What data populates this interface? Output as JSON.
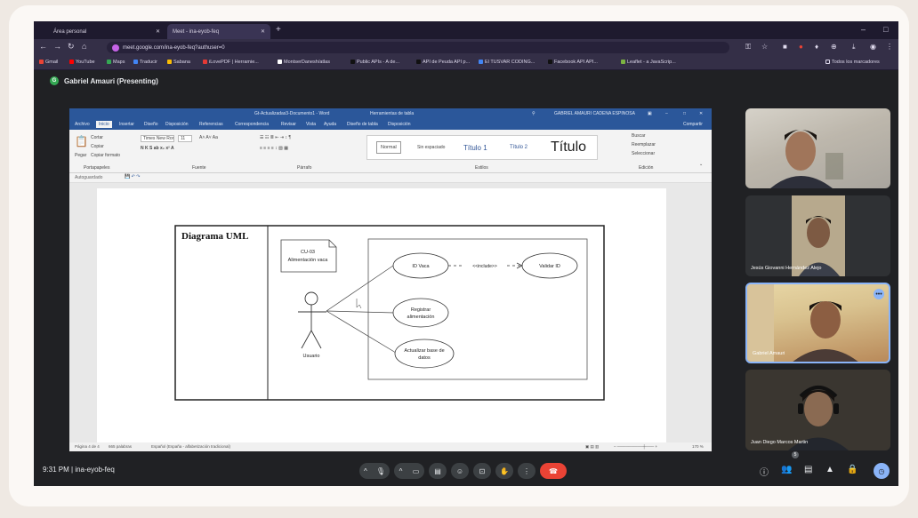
{
  "browser": {
    "tabs": [
      {
        "label": "Área personal"
      },
      {
        "label": "Meet - ina-eyob-feq"
      }
    ],
    "url": "meet.google.com/ina-eyob-feq?authuser=0",
    "bookmarks": [
      "Gmail",
      "YouTube",
      "Maps",
      "Traducir",
      "Sabana",
      "iLovePDF | Herramie...",
      "MontserDanesh/atlas",
      "Public APIs - A de...",
      "API de Peuda API p...",
      "El TUSVAR CODING...",
      "Facebook API API...",
      "Leaflet - a JavaScrip..."
    ],
    "all_bookmarks": "Todos los marcadores"
  },
  "meet": {
    "presenter_initial": "G",
    "presenter_label": "Gabriel Amauri (Presenting)",
    "meeting_time": "9:31 PM",
    "meeting_code": "ina-eyob-feq",
    "participant_count": "5",
    "participants": [
      {
        "name": ""
      },
      {
        "name": "Jesús Giovanni Hernández Alejo"
      },
      {
        "name": "Gabriel Amauri"
      },
      {
        "name": "Juan Diego Marcos Martin"
      }
    ]
  },
  "word": {
    "doc_title": "Gt-Actualizadas3-Documento1 - Word",
    "tools_label": "Herramientas de tabla",
    "user": "GABRIEL AMAURI CADENA ESPINOSA",
    "tabs": [
      "Archivo",
      "Inicio",
      "Insertar",
      "Diseño",
      "Disposición",
      "Referencias",
      "Correspondencia",
      "Revisar",
      "Vista",
      "Ayuda",
      "Diseño de tabla",
      "Disposición"
    ],
    "share": "Compartir",
    "ribbon": {
      "cut": "Cortar",
      "copy": "Copiar",
      "paste": "Pegar",
      "format_painter": "Copiar formato",
      "clipboard": "Portapapeles",
      "font_name": "Times New Roman",
      "font_size": "11",
      "font_group": "Fuente",
      "paragraph_group": "Párrafo",
      "styles_group": "Estilos",
      "editing_group": "Edición",
      "find": "Buscar",
      "replace": "Reemplazar",
      "select": "Seleccionar"
    },
    "styles": [
      "Normal",
      "Sin espaciado",
      "Título 1",
      "Título 2",
      "Título"
    ],
    "qat_label": "Autoguardado",
    "status": {
      "page": "Página 4 de 4",
      "words": "665 palabras",
      "language": "Español (España - alfabetización tradicional)",
      "zoom": "170 %"
    }
  },
  "diagram": {
    "title": "Diagrama UML",
    "note_line1": "CU-03",
    "note_line2": "Alimentación vaca",
    "actor": "Usuario",
    "use_cases": [
      "ID Vaca",
      "Validar ID",
      "Registrar alimentación",
      "Actualizar base de datos"
    ],
    "include": "<<include>>"
  }
}
